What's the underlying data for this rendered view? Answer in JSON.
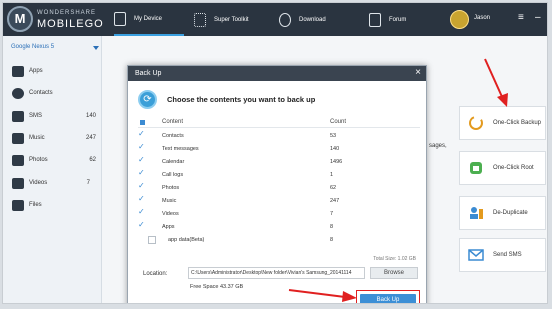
{
  "app": {
    "brand_top": "WONDERSHARE",
    "brand_bottom": "MOBILEGO",
    "logo_letter": "M"
  },
  "tabs": [
    {
      "label": "My Device",
      "icon": "phone-icon"
    },
    {
      "label": "Super Toolkit",
      "icon": "grid-icon"
    },
    {
      "label": "Download",
      "icon": "globe-icon"
    },
    {
      "label": "Forum",
      "icon": "forum-icon"
    }
  ],
  "user": {
    "name": "Jason"
  },
  "window_controls": {
    "menu": "≡",
    "minimize": "–"
  },
  "sidebar": {
    "device": "Google Nexus 5",
    "items": [
      {
        "label": "Apps",
        "count": "",
        "icon": "apps-icon"
      },
      {
        "label": "Contacts",
        "count": "",
        "icon": "contacts-icon"
      },
      {
        "label": "SMS",
        "count": "140",
        "icon": "sms-icon"
      },
      {
        "label": "Music",
        "count": "247",
        "icon": "music-icon"
      },
      {
        "label": "Photos",
        "count": "62",
        "icon": "photos-icon"
      },
      {
        "label": "Videos",
        "count": "7",
        "icon": "videos-icon"
      },
      {
        "label": "Files",
        "count": "",
        "icon": "files-icon"
      }
    ]
  },
  "main": {
    "partial_text": "sages,"
  },
  "features": [
    {
      "label": "One-Click Backup",
      "icon": "backup-icon"
    },
    {
      "label": "One-Click Root",
      "icon": "android-icon"
    },
    {
      "label": "De-Duplicate",
      "icon": "deduplicate-icon"
    },
    {
      "label": "Send SMS",
      "icon": "send-sms-icon"
    }
  ],
  "dialog": {
    "title": "Back Up",
    "close": "×",
    "heading": "Choose the contents you want to back up",
    "col_content": "Content",
    "col_count": "Count",
    "rows": [
      {
        "name": "Contacts",
        "count": "53",
        "checked": true
      },
      {
        "name": "Text messages",
        "count": "140",
        "checked": true
      },
      {
        "name": "Calendar",
        "count": "1496",
        "checked": true
      },
      {
        "name": "Call logs",
        "count": "1",
        "checked": true
      },
      {
        "name": "Photos",
        "count": "62",
        "checked": true
      },
      {
        "name": "Music",
        "count": "247",
        "checked": true
      },
      {
        "name": "Videos",
        "count": "7",
        "checked": true
      },
      {
        "name": "Apps",
        "count": "8",
        "checked": true
      },
      {
        "name": "app data(Beta)",
        "count": "8",
        "checked": false
      }
    ],
    "total_size": "Total Size: 1.02 GB",
    "location_label": "Location:",
    "location_value": "C:\\Users\\Administrator\\Desktop\\New folder\\Vivian's Samsung_20141114",
    "browse": "Browse",
    "free_space": "Free Space 43.37 GB",
    "backup_button": "Back Up"
  },
  "colors": {
    "accent": "#3c8fd6",
    "topbar": "#2a3440",
    "highlight": "#e02020"
  }
}
